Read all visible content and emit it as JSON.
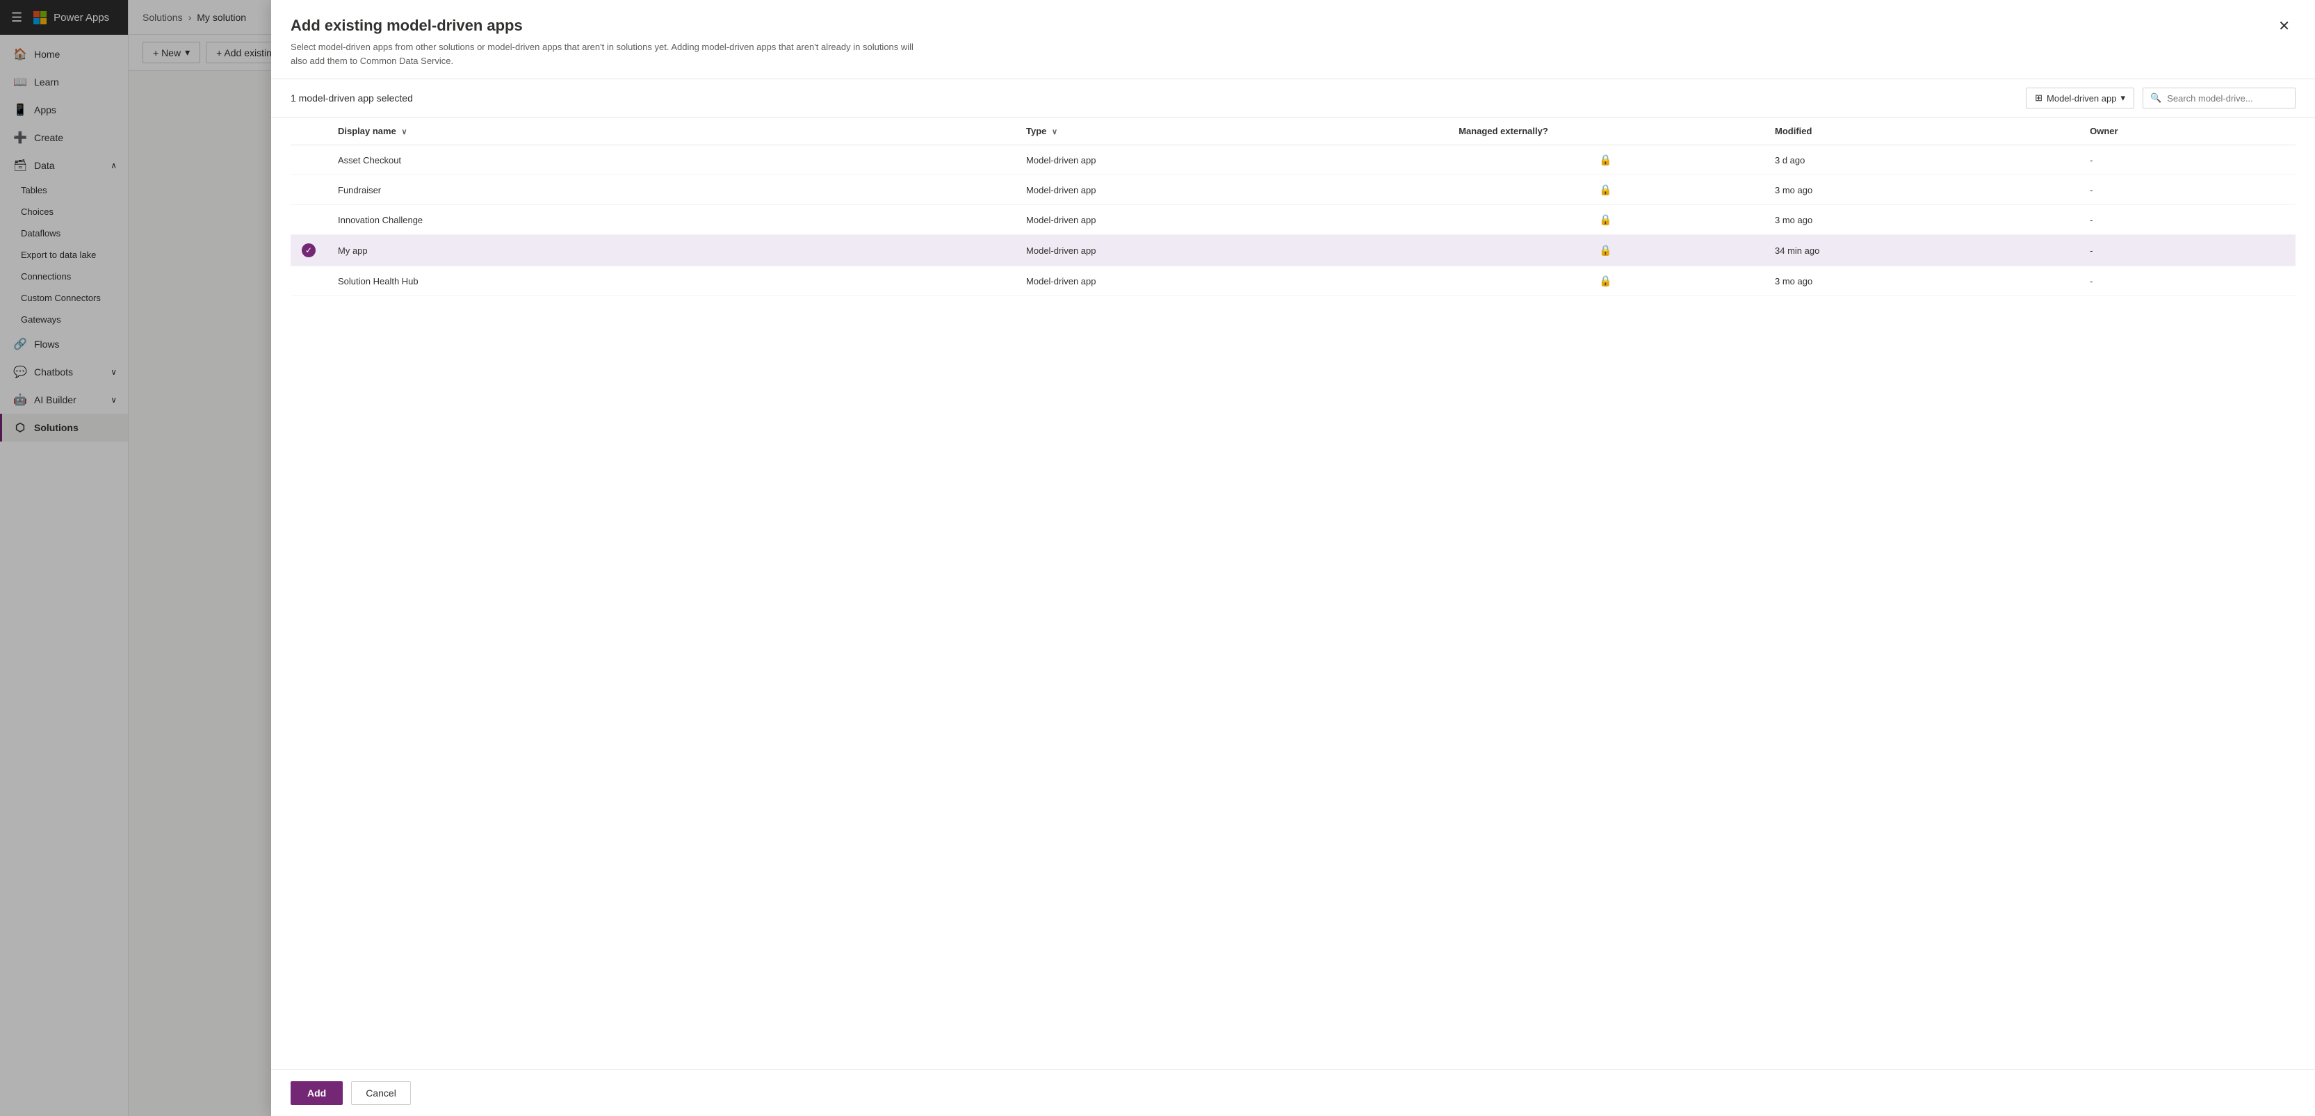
{
  "app": {
    "name": "Power Apps"
  },
  "sidebar": {
    "hamburger_label": "☰",
    "nav_items": [
      {
        "id": "home",
        "label": "Home",
        "icon": "🏠",
        "active": false
      },
      {
        "id": "learn",
        "label": "Learn",
        "icon": "📖",
        "active": false
      },
      {
        "id": "apps",
        "label": "Apps",
        "icon": "📱",
        "active": false
      },
      {
        "id": "create",
        "label": "Create",
        "icon": "➕",
        "active": false
      },
      {
        "id": "data",
        "label": "Data",
        "icon": "🗃",
        "active": false,
        "expanded": true
      },
      {
        "id": "tables",
        "label": "Tables",
        "icon": "",
        "sub": true
      },
      {
        "id": "choices",
        "label": "Choices",
        "icon": "",
        "sub": true
      },
      {
        "id": "dataflows",
        "label": "Dataflows",
        "icon": "",
        "sub": true
      },
      {
        "id": "export",
        "label": "Export to data lake",
        "icon": "",
        "sub": true
      },
      {
        "id": "connections",
        "label": "Connections",
        "icon": "",
        "sub": true
      },
      {
        "id": "custom-connectors",
        "label": "Custom Connectors",
        "icon": "",
        "sub": true
      },
      {
        "id": "gateways",
        "label": "Gateways",
        "icon": "",
        "sub": true
      },
      {
        "id": "flows",
        "label": "Flows",
        "icon": "🔗",
        "active": false
      },
      {
        "id": "chatbots",
        "label": "Chatbots",
        "icon": "💬",
        "active": false,
        "chevron": true
      },
      {
        "id": "ai-builder",
        "label": "AI Builder",
        "icon": "🤖",
        "active": false,
        "chevron": true
      },
      {
        "id": "solutions",
        "label": "Solutions",
        "icon": "⬡",
        "active": true
      }
    ]
  },
  "toolbar": {
    "new_label": "+ New",
    "new_chevron": "▾",
    "add_existing_label": "+ Add existing"
  },
  "breadcrumb": {
    "solutions_label": "Solutions",
    "separator": "›",
    "current_label": "My solution"
  },
  "modal": {
    "title": "Add existing model-driven apps",
    "description": "Select model-driven apps from other solutions or model-driven apps that aren't in solutions yet. Adding model-driven apps that aren't already in solutions will also add them to Common Data Service.",
    "close_label": "✕",
    "selected_count": "1 model-driven app selected",
    "filter_label": "Model-driven app",
    "filter_icon": "⊞",
    "filter_chevron": "▾",
    "search_placeholder": "Search model-drive...",
    "search_icon": "🔍",
    "columns": {
      "display_name": "Display name",
      "display_name_sort": "∨",
      "type": "Type",
      "type_sort": "∨",
      "managed_externally": "Managed externally?",
      "modified": "Modified",
      "owner": "Owner"
    },
    "rows": [
      {
        "id": 1,
        "display_name": "Asset Checkout",
        "type": "Model-driven app",
        "managed": true,
        "modified": "3 d ago",
        "owner": "-",
        "selected": false
      },
      {
        "id": 2,
        "display_name": "Fundraiser",
        "type": "Model-driven app",
        "managed": true,
        "modified": "3 mo ago",
        "owner": "-",
        "selected": false
      },
      {
        "id": 3,
        "display_name": "Innovation Challenge",
        "type": "Model-driven app",
        "managed": true,
        "modified": "3 mo ago",
        "owner": "-",
        "selected": false
      },
      {
        "id": 4,
        "display_name": "My app",
        "type": "Model-driven app",
        "managed": true,
        "modified": "34 min ago",
        "owner": "-",
        "selected": true
      },
      {
        "id": 5,
        "display_name": "Solution Health Hub",
        "type": "Model-driven app",
        "managed": true,
        "modified": "3 mo ago",
        "owner": "-",
        "selected": false
      }
    ],
    "add_label": "Add",
    "cancel_label": "Cancel"
  }
}
